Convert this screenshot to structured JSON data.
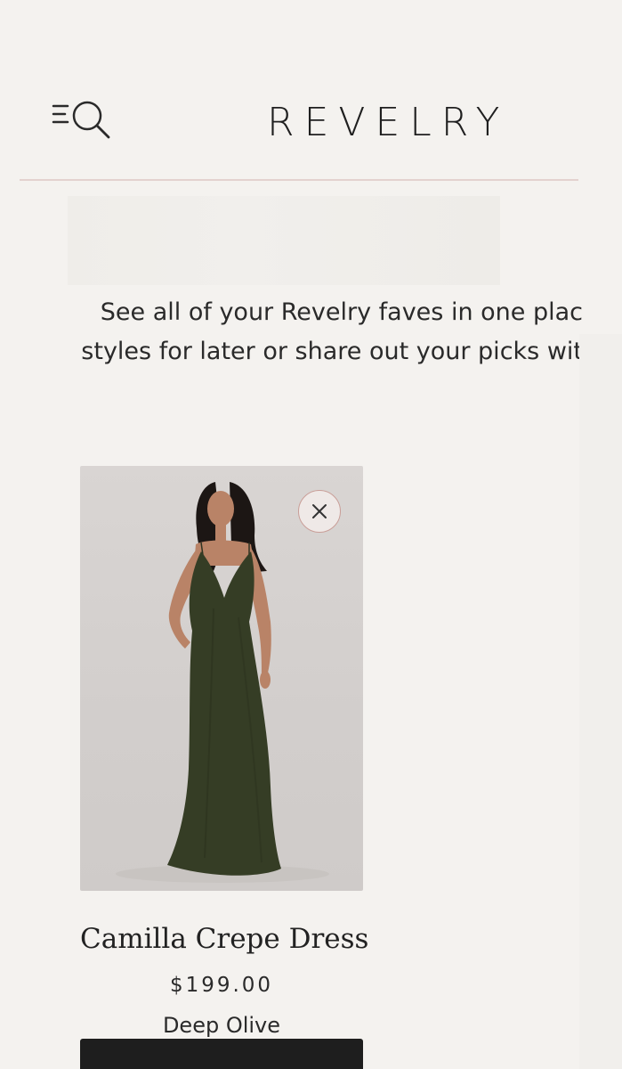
{
  "header": {
    "logo": "REVELRY",
    "menu_search_icon": "menu-search-icon"
  },
  "intro": {
    "line1": "See all of your Revelry faves in one plac",
    "line2": "styles for later or share out your picks wit"
  },
  "favorites": [
    {
      "name": "Camilla Crepe Dress",
      "price": "$199.00",
      "color": "Deep Olive",
      "remove_icon": "close-icon",
      "annotation_color": "#3aa8a0"
    }
  ],
  "colors": {
    "background": "#f4f2ef",
    "divider": "#e3d2cf",
    "remove_border": "#c99e98",
    "dress": "#353d25",
    "button": "#1e1e1e"
  }
}
